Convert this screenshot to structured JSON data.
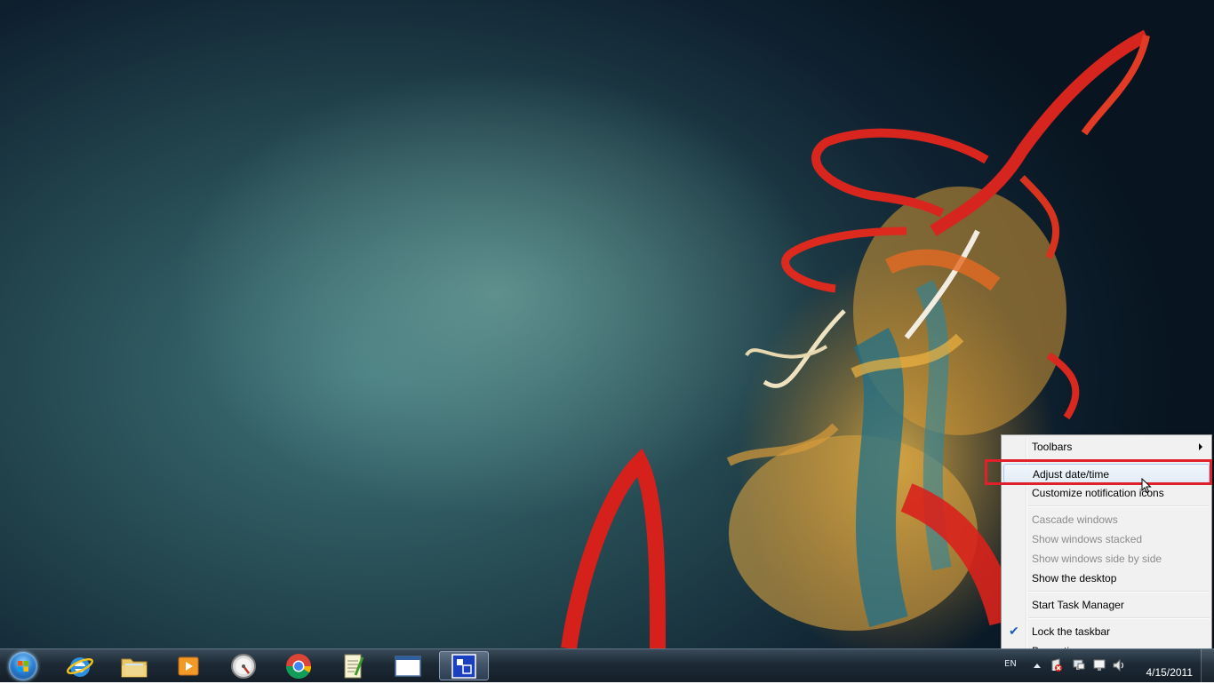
{
  "desktop": {
    "wallpaper": "abstract-colorful-strands"
  },
  "taskbar": {
    "start_icon": "windows-logo-icon",
    "pinned": [
      {
        "name": "internet-explorer",
        "icon": "internet-explorer-icon"
      },
      {
        "name": "windows-explorer",
        "icon": "folder-icon"
      },
      {
        "name": "media-player",
        "icon": "media-player-icon"
      },
      {
        "name": "speedometer-app",
        "icon": "gauge-icon"
      },
      {
        "name": "google-chrome",
        "icon": "chrome-icon"
      },
      {
        "name": "notepad-app",
        "icon": "notepad-icon"
      },
      {
        "name": "window-app",
        "icon": "window-icon"
      },
      {
        "name": "screenshot-app",
        "icon": "screen-capture-icon",
        "active": true
      }
    ],
    "tray": {
      "language": "EN",
      "date": "4/15/2011",
      "icons": [
        "show-hidden-icons-arrow",
        "action-center-icon",
        "network-icon",
        "monitor-icon",
        "volume-icon"
      ]
    }
  },
  "context_menu": {
    "items": {
      "toolbars": "Toolbars",
      "adjust_datetime": "Adjust date/time",
      "customize_icons": "Customize notification icons",
      "cascade": "Cascade windows",
      "stacked": "Show windows stacked",
      "side_by_side": "Show windows side by side",
      "show_desktop": "Show the desktop",
      "task_manager": "Start Task Manager",
      "lock_taskbar": "Lock the taskbar",
      "properties": "Properties"
    },
    "lock_taskbar_checked": true,
    "highlight_color": "#e0202a",
    "check_color": "#1b5fb3"
  }
}
